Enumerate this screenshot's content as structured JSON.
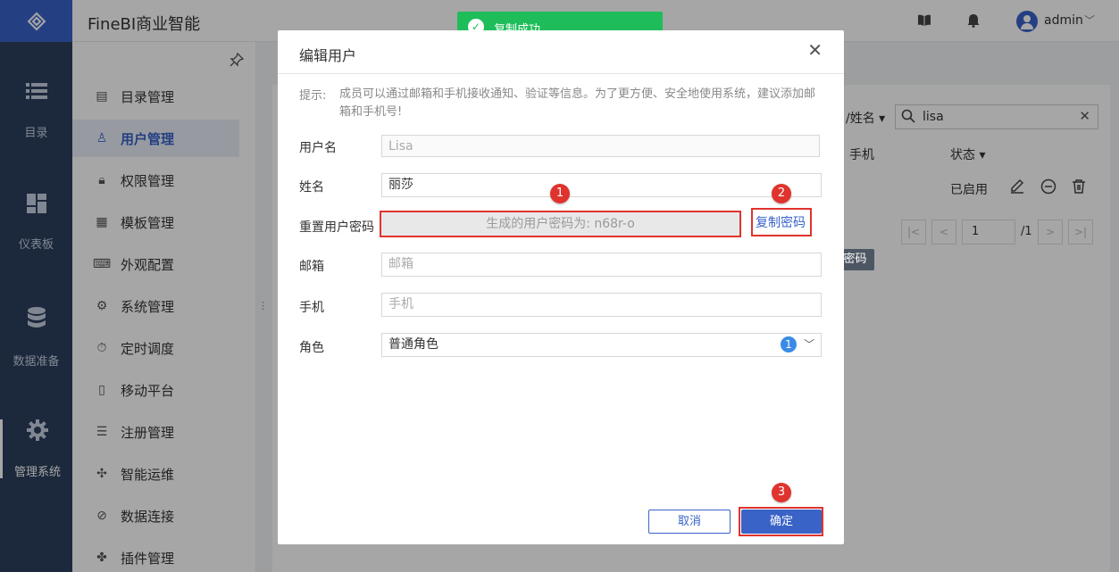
{
  "app": {
    "title": "FineBI商业智能",
    "username": "admin"
  },
  "rail": {
    "items": [
      {
        "label": "目录",
        "icon": "list-icon"
      },
      {
        "label": "仪表板",
        "icon": "dashboard-icon"
      },
      {
        "label": "数据准备",
        "icon": "database-icon"
      },
      {
        "label": "管理系统",
        "icon": "gear-icon"
      }
    ]
  },
  "menu": {
    "items": [
      {
        "label": "目录管理"
      },
      {
        "label": "用户管理"
      },
      {
        "label": "权限管理"
      },
      {
        "label": "模板管理"
      },
      {
        "label": "外观配置"
      },
      {
        "label": "系统管理"
      },
      {
        "label": "定时调度"
      },
      {
        "label": "移动平台"
      },
      {
        "label": "注册管理"
      },
      {
        "label": "智能运维"
      },
      {
        "label": "数据连接"
      },
      {
        "label": "插件管理"
      }
    ]
  },
  "background": {
    "filter_label": "名/姓名",
    "search_value": "lisa",
    "col_phone": "手机",
    "col_status": "状态",
    "row_status": "已启用",
    "page_current": "1",
    "page_total": "/1"
  },
  "toast": {
    "text": "复制成功"
  },
  "tooltip": {
    "text": "复制密码"
  },
  "dialog": {
    "title": "编辑用户",
    "hint_label": "提示:",
    "hint_text": "成员可以通过邮箱和手机接收通知、验证等信息。为了更方便、安全地使用系统，建议添加邮箱和手机号!",
    "fields": {
      "username": {
        "label": "用户名",
        "value": "Lisa"
      },
      "realname": {
        "label": "姓名",
        "value": "丽莎"
      },
      "password": {
        "label": "重置用户密码",
        "value": "生成的用户密码为: n68r-o",
        "copy": "复制密码"
      },
      "email": {
        "label": "邮箱",
        "placeholder": "邮箱"
      },
      "phone": {
        "label": "手机",
        "placeholder": "手机"
      },
      "role": {
        "label": "角色",
        "value": "普通角色",
        "count": "1"
      }
    },
    "cancel": "取消",
    "ok": "确定"
  },
  "markers": [
    "1",
    "2",
    "3"
  ],
  "colors": {
    "accent": "#3a63c8",
    "rail": "#2c3e5c",
    "success": "#1ebd5a",
    "highlight": "#e0332d"
  }
}
